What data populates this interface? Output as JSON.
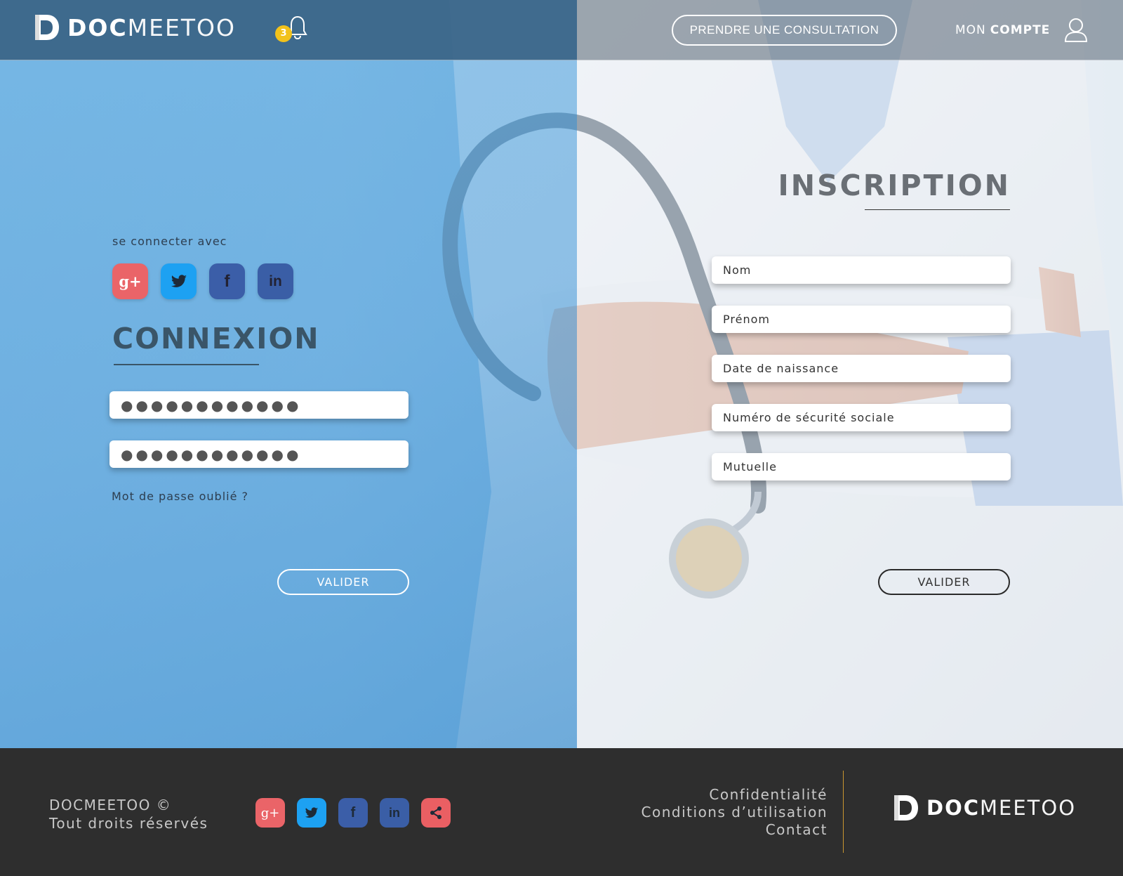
{
  "header": {
    "logo_bold": "DOC",
    "logo_light": "MEETOO",
    "notification_count": "3",
    "consult_button": "PRENDRE UNE CONSULTATION",
    "account_prefix": "MON",
    "account_bold": "COMPTE"
  },
  "login": {
    "connect_with": "se connecter avec",
    "socials": [
      {
        "name": "google-plus",
        "glyph": "g+"
      },
      {
        "name": "twitter",
        "glyph": "twitter-bird"
      },
      {
        "name": "facebook",
        "glyph": "f"
      },
      {
        "name": "linkedin",
        "glyph": "in"
      }
    ],
    "title": "CONNEXION",
    "field1_value": "●●●●●●●●●●●●",
    "field2_value": "●●●●●●●●●●●●",
    "forgot": "Mot de passe oublié ?",
    "submit": "VALIDER"
  },
  "signup": {
    "title": "INSCRIPTION",
    "fields": [
      {
        "placeholder": "Nom"
      },
      {
        "placeholder": "Prénom"
      },
      {
        "placeholder": "Date de naissance"
      },
      {
        "placeholder": "Numéro de sécurité sociale"
      },
      {
        "placeholder": "Mutuelle"
      }
    ],
    "submit": "VALIDER"
  },
  "footer": {
    "copyright": "DOCMEETOO ©",
    "rights": "Tout droits réservés",
    "links": [
      "Confidentialité",
      "Conditions d’utilisation",
      "Contact"
    ],
    "logo_bold": "DOC",
    "logo_light": "MEETOO"
  },
  "colors": {
    "accent_yellow": "#f2c21b",
    "google_red": "#ea6468",
    "twitter_blue": "#1da1f2",
    "facebook_blue": "#3b5ea8",
    "linkedin_blue": "#3a5ea6",
    "footer_bg": "#2e2e2e",
    "divider_gold": "#c9962f"
  }
}
